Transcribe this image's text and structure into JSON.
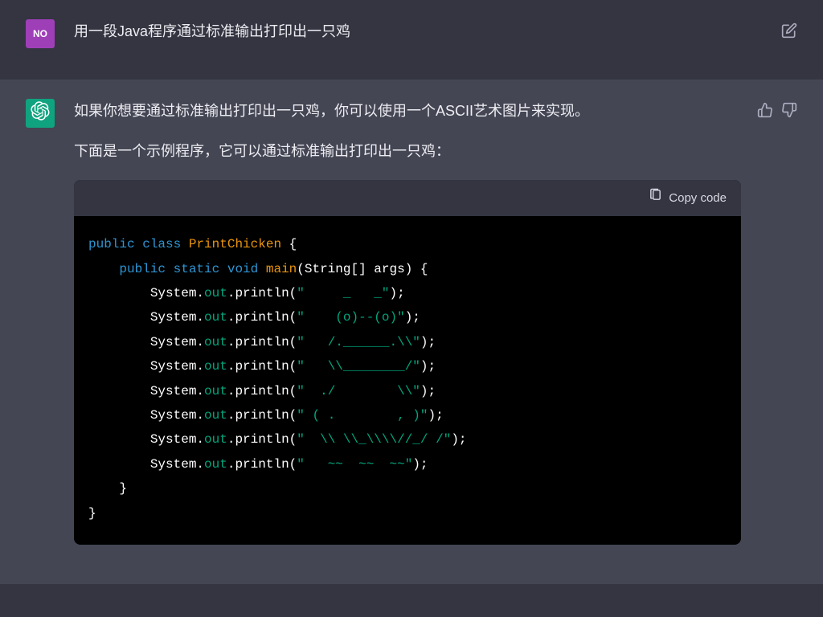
{
  "user": {
    "avatar_text": "NO",
    "message": "用一段Java程序通过标准输出打印出一只鸡"
  },
  "assistant": {
    "p1": "如果你想要通过标准输出打印出一只鸡，你可以使用一个ASCII艺术图片来实现。",
    "p2": "下面是一个示例程序，它可以通过标准输出打印出一只鸡：",
    "copy_label": "Copy code",
    "code": {
      "kw_public": "public",
      "kw_class": "class",
      "cls_name": "PrintChicken",
      "kw_static": "static",
      "kw_void": "void",
      "fn_main": "main",
      "sig_args": "(String[] args) {",
      "sys": "System",
      "out": "out",
      "println": "println",
      "s1": "\"     _   _\"",
      "s2": "\"    (o)--(o)\"",
      "s3": "\"   /.______.\\\\\"",
      "s4": "\"   \\\\________/\"",
      "s5": "\"  ./        \\\\\"",
      "s6": "\" ( .        , )\"",
      "s7": "\"  \\\\ \\\\_\\\\\\\\//_/ /\"",
      "s8": "\"   ~~  ~~  ~~\"",
      "brace_open": " {",
      "brace_close1": "    }",
      "brace_close2": "}",
      "dot": ".",
      "lp": "(",
      "rp": ");"
    }
  }
}
